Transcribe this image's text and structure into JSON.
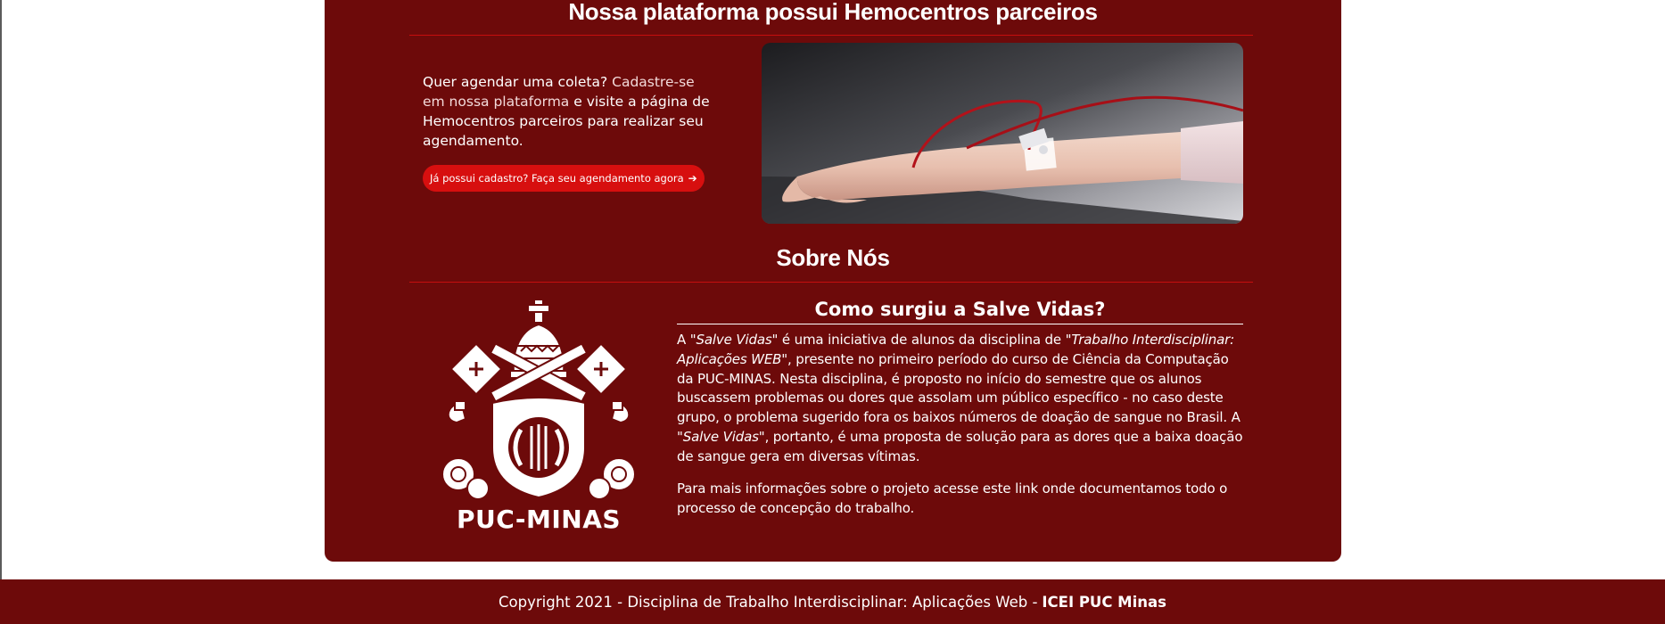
{
  "partners": {
    "title": "Nossa plataforma possui Hemocentros parceiros",
    "intro_a": "Quer agendar uma coleta? ",
    "intro_b": "Cadastre-se em nossa plataforma",
    "intro_c": " e visite a página de Hemocentros parceiros para realizar seu agendamento.",
    "cta_label": "Já possui cadastro? Faça seu agendamento agora",
    "cta_icon": "arrow-right-icon"
  },
  "about": {
    "title": "Sobre Nós",
    "crest_label": "PUC-MINAS",
    "subtitle": "Como surgiu a Salve Vidas?",
    "p1_a": "A ",
    "p1_b": "\"Salve Vidas\"",
    "p1_c": " é uma iniciativa de alunos da disciplina de ",
    "p1_d": "\"Trabalho Interdisciplinar: Aplicações WEB\"",
    "p1_e": ", presente no primeiro período do curso de Ciência da Computação da PUC-MINAS. Nesta disciplina, é proposto no início do semestre que os alunos buscassem problemas ou dores que assolam um público específico - no caso deste grupo, o problema sugerido fora os baixos números de doação de sangue no Brasil. A ",
    "p1_f": "\"Salve Vidas\"",
    "p1_g": ", portanto, é uma proposta de solução para as dores que a baixa doação de sangue gera em diversas vítimas.",
    "p2_a": "Para mais informações sobre o projeto acesse ",
    "p2_link": "este link",
    "p2_b": " onde documentamos todo o processo de concepção do trabalho."
  },
  "footer": {
    "text": "Copyright 2021 - Disciplina de Trabalho Interdisciplinar: Aplicações Web -",
    "brand": "ICEI PUC Minas"
  },
  "colors": {
    "card_bg": "#6d0a0a",
    "accent_red": "#d70f0f",
    "rule_red": "#c50e0e"
  }
}
